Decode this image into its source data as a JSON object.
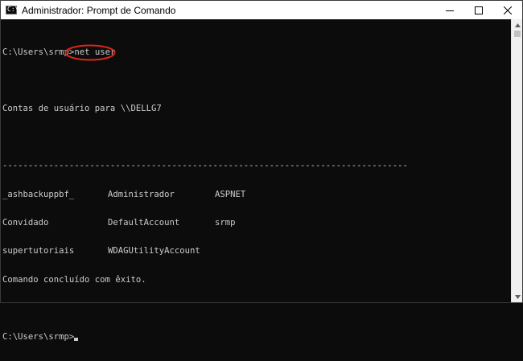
{
  "window": {
    "title": "Administrador: Prompt de Comando",
    "icon": "cmd-icon",
    "icon_glyph": "C:\\",
    "controls": [
      "minimize",
      "maximize",
      "close"
    ]
  },
  "console": {
    "prompt1": "C:\\Users\\srmp",
    "prompt1_sep": ">",
    "command": "net user",
    "accounts_header": "Contas de usuário para \\\\DELLG7",
    "separator": "-------------------------------------------------------------------------------",
    "accounts": [
      [
        "_ashbackuppbf_",
        "Administrador",
        "ASPNET"
      ],
      [
        "Convidado",
        "DefaultAccount",
        "srmp"
      ],
      [
        "supertutoriais",
        "WDAGUtilityAccount",
        ""
      ]
    ],
    "completion": "Comando concluído com êxito.",
    "prompt2": "C:\\Users\\srmp>"
  },
  "annotation": {
    "shape": "ellipse",
    "color": "#d9261c"
  }
}
